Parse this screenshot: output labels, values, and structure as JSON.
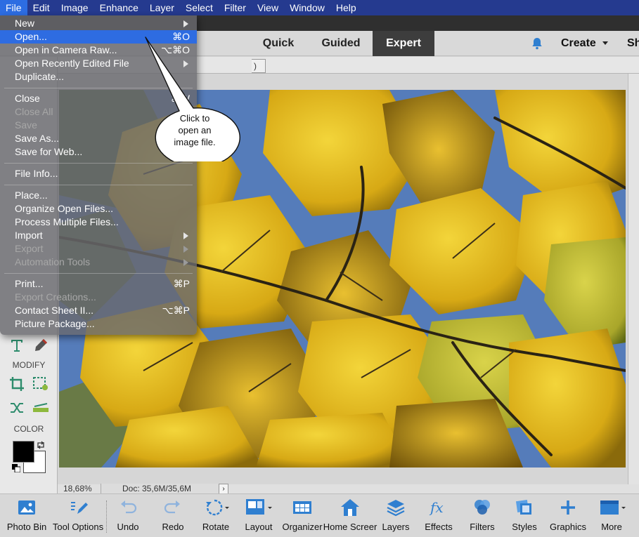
{
  "menubar": {
    "items": [
      "File",
      "Edit",
      "Image",
      "Enhance",
      "Layer",
      "Select",
      "Filter",
      "View",
      "Window",
      "Help"
    ]
  },
  "modes": {
    "quick": "Quick",
    "guided": "Guided",
    "expert": "Expert"
  },
  "header": {
    "create": "Create",
    "share": "Sh",
    "tab_fragment": ")"
  },
  "toolbox": {
    "modify_label": "MODIFY",
    "color_label": "COLOR"
  },
  "status": {
    "zoom": "18,68%",
    "doc": "Doc: 35,6M/35,6M",
    "arrow": "›"
  },
  "file_menu": {
    "new": "New",
    "open": "Open...",
    "open_sc": "⌘O",
    "camera_raw": "Open in Camera Raw...",
    "camera_raw_sc": "⌥⌘O",
    "recent": "Open Recently Edited File",
    "duplicate": "Duplicate...",
    "close": "Close",
    "close_sc": "⌘W",
    "close_all": "Close All",
    "save": "Save",
    "save_as": "Save As...",
    "save_web": "Save for Web...",
    "save_web_sc": "⌥⇧",
    "file_info": "File Info...",
    "place": "Place...",
    "organize": "Organize Open Files...",
    "process": "Process Multiple Files...",
    "import": "Import",
    "export": "Export",
    "automation": "Automation Tools",
    "print": "Print...",
    "print_sc": "⌘P",
    "export_creations": "Export Creations...",
    "contact_sheet": "Contact Sheet II...",
    "contact_sheet_sc": "⌥⌘P",
    "picture_package": "Picture Package..."
  },
  "callout": {
    "line1": "Click to",
    "line2": "open an",
    "line3": "image file."
  },
  "bottom": {
    "photo_bin": "Photo Bin",
    "tool_options": "Tool Options",
    "undo": "Undo",
    "redo": "Redo",
    "rotate": "Rotate",
    "layout": "Layout",
    "organizer": "Organizer",
    "home": "Home Screer",
    "layers": "Layers",
    "effects": "Effects",
    "filters": "Filters",
    "styles": "Styles",
    "graphics": "Graphics",
    "more": "More"
  },
  "colors": {
    "accent": "#2e6ce1",
    "menubar": "#253a8f",
    "icon_blue": "#2f7fd0"
  }
}
